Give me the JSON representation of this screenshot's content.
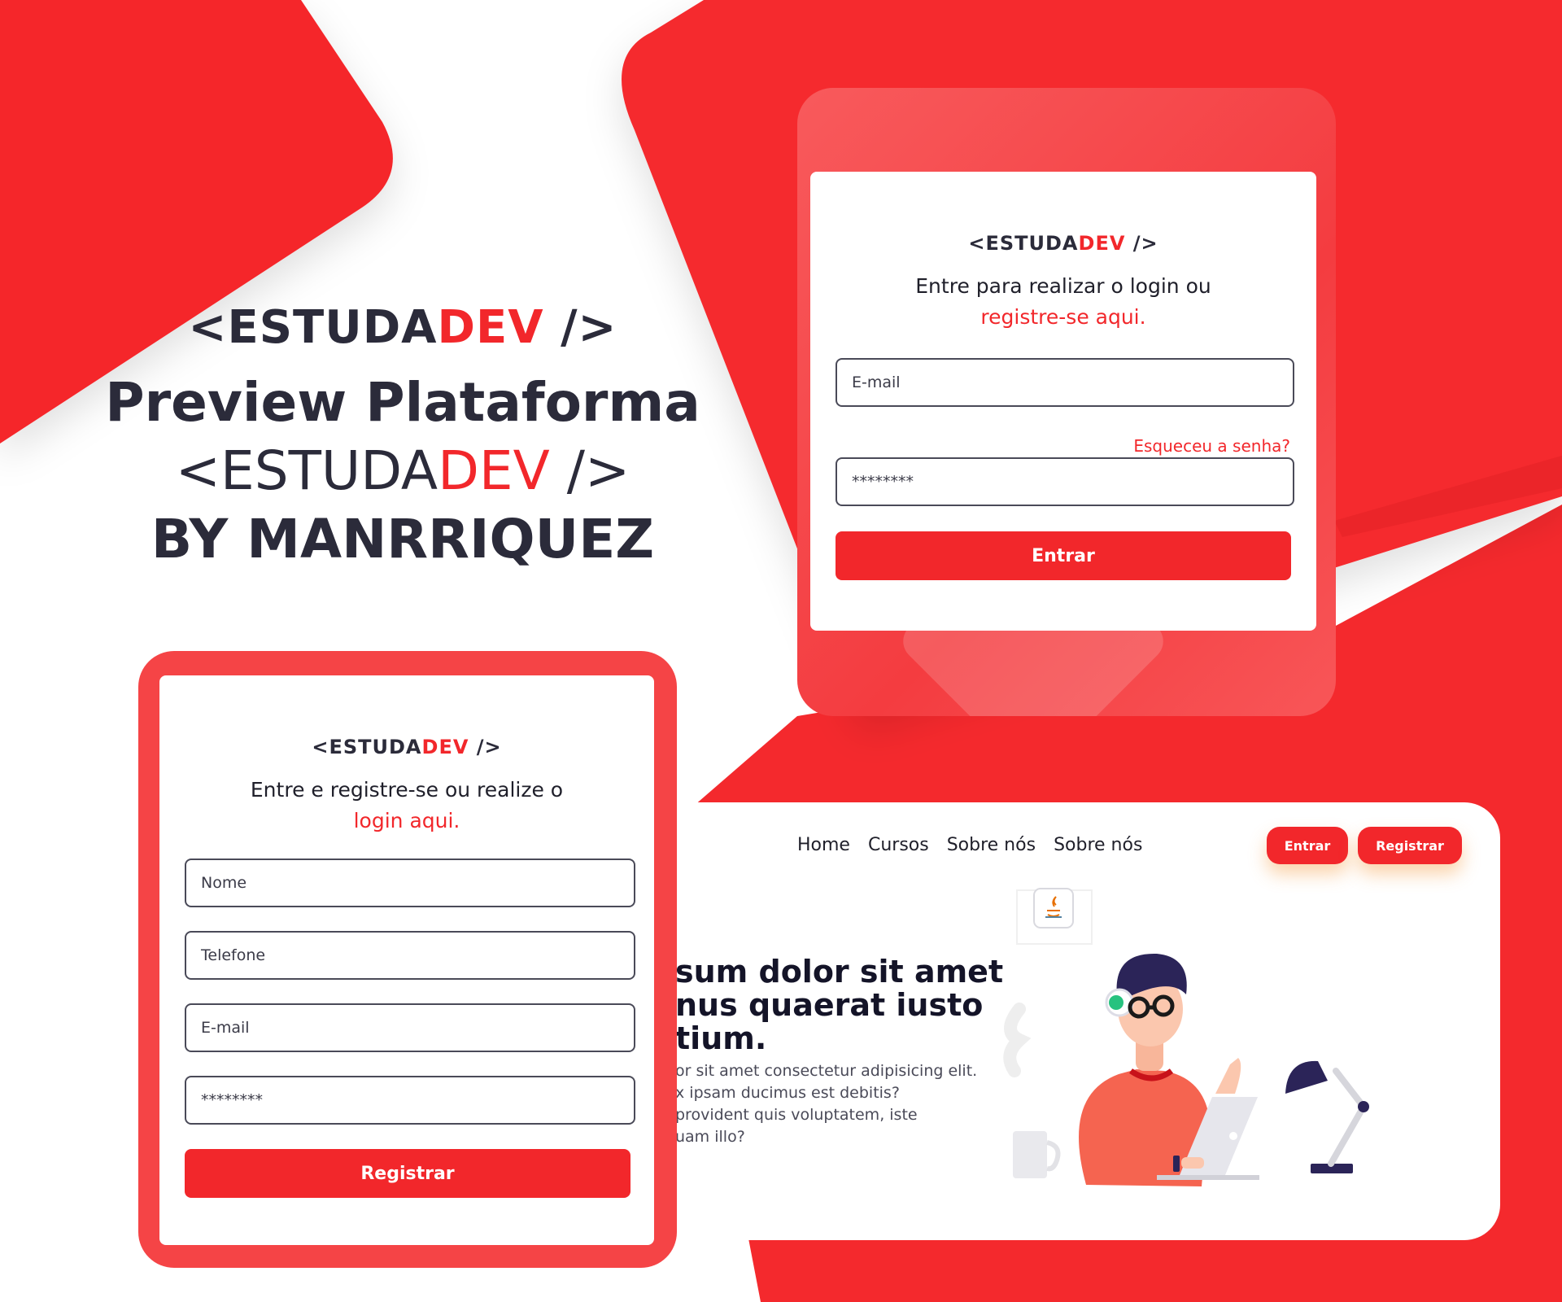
{
  "colors": {
    "brand_red": "#f2272b",
    "dark": "#2b2b3a",
    "card_frame": "#f54446"
  },
  "brand": {
    "logo_open": "<ESTUDA",
    "logo_accent": "DEV",
    "logo_close": " />"
  },
  "hero": {
    "title_line1": "Preview Plataforma",
    "title_logo_open": "<ESTUDA",
    "title_logo_accent": "DEV",
    "title_logo_close": " />",
    "title_line3": "BY MANRRIQUEZ"
  },
  "login": {
    "lead": "Entre para realizar o login ou",
    "lead_link": "registre-se aqui.",
    "email_placeholder": "E-mail",
    "forgot_link": "Esqueceu a senha?",
    "password_value": "********",
    "submit_label": "Entrar"
  },
  "register": {
    "lead": "Entre e registre-se ou realize o",
    "lead_link": "login aqui.",
    "name_placeholder": "Nome",
    "phone_placeholder": "Telefone",
    "email_placeholder": "E-mail",
    "password_value": "********",
    "submit_label": "Registrar"
  },
  "landing": {
    "nav": [
      "Home",
      "Cursos",
      "Sobre nós",
      "Sobre nós"
    ],
    "login_button": "Entrar",
    "register_button": "Registrar",
    "headline": [
      "sum dolor sit amet",
      "nus quaerat iusto",
      "tium."
    ],
    "body": [
      "or sit amet consectetur adipisicing elit.",
      "x ipsam ducimus est debitis?",
      "provident quis voluptatem, iste",
      "uam illo?"
    ],
    "icons": {
      "badge": "java-icon",
      "mug": "coffee-mug-icon",
      "lamp": "desk-lamp-icon",
      "person": "developer-illustration",
      "laptop": "laptop-icon"
    }
  }
}
